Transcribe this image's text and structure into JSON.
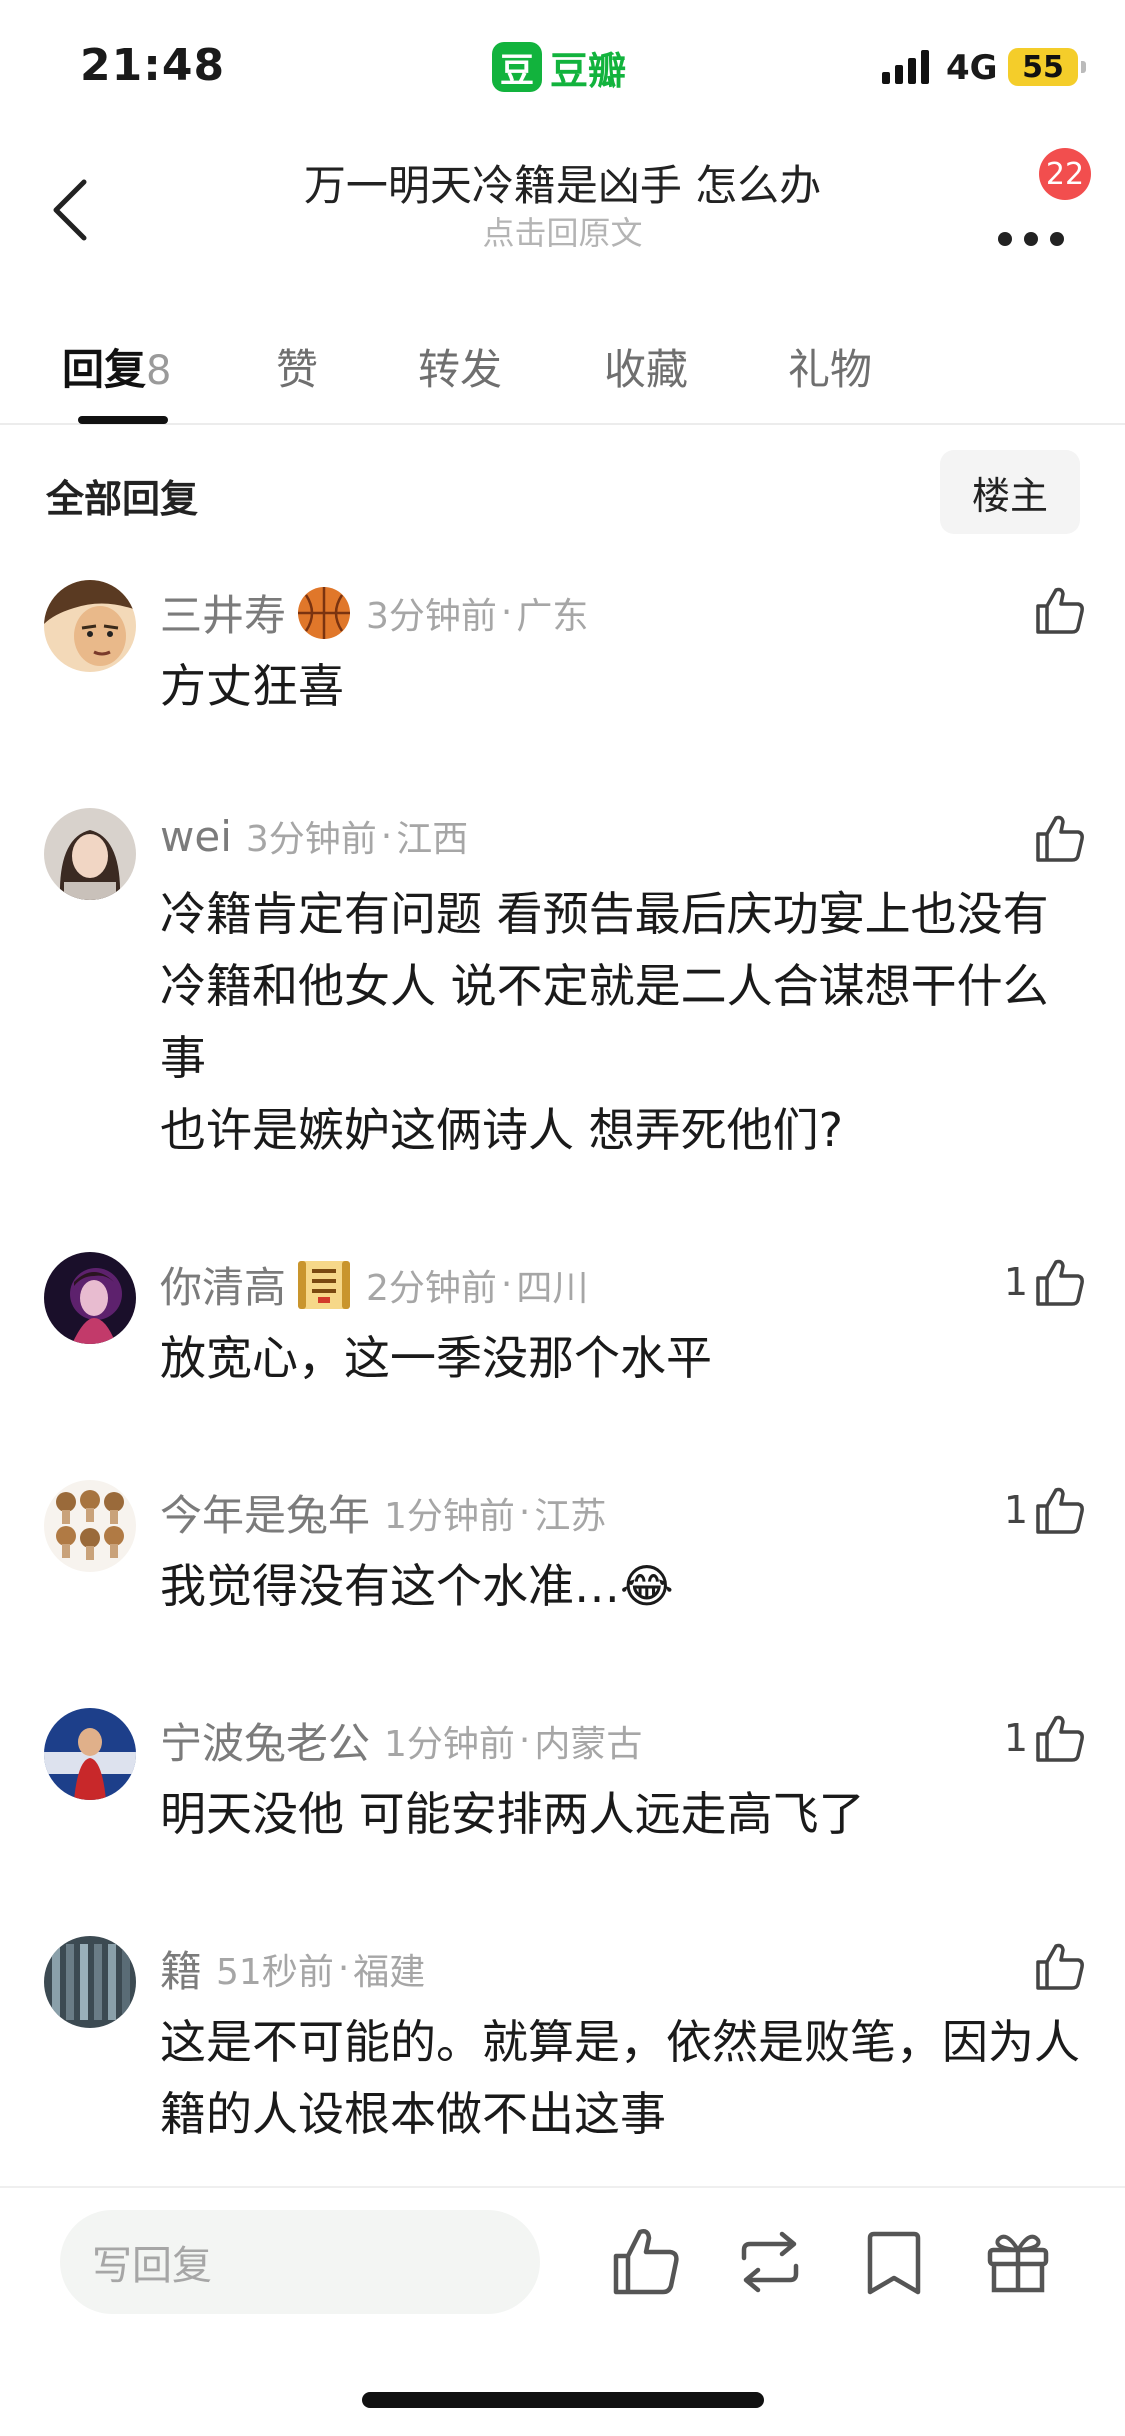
{
  "status_bar": {
    "time": "21:48",
    "app_logo_char": "豆",
    "app_name": "豆瓣",
    "network": "4G",
    "battery": "55"
  },
  "header": {
    "title": "万一明天冷籍是凶手 怎么办",
    "subtitle": "点击回原文",
    "notification_count": "22"
  },
  "tabs": [
    {
      "label": "回复",
      "count": "8",
      "active": true
    },
    {
      "label": "赞"
    },
    {
      "label": "转发"
    },
    {
      "label": "收藏"
    },
    {
      "label": "礼物"
    }
  ],
  "section": {
    "title": "全部回复",
    "filter_button": "楼主"
  },
  "comments": [
    {
      "name": "三井寿",
      "badge_icon": "basketball-icon",
      "time": "3分钟前",
      "location": "广东",
      "text": "方丈狂喜",
      "likes": ""
    },
    {
      "name": "wei",
      "time": "3分钟前",
      "location": "江西",
      "text": "冷籍肯定有问题 看预告最后庆功宴上也没有冷籍和他女人 说不定就是二人合谋想干什么事\n也许是嫉妒这俩诗人 想弄死他们?",
      "likes": ""
    },
    {
      "name": "你清高",
      "badge_icon": "scroll-badge-icon",
      "time": "2分钟前",
      "location": "四川",
      "text": "放宽心，这一季没那个水平",
      "likes": "1"
    },
    {
      "name": "今年是兔年",
      "time": "1分钟前",
      "location": "江苏",
      "text": "我觉得没有这个水准…😂",
      "likes": "1"
    },
    {
      "name": "宁波兔老公",
      "time": "1分钟前",
      "location": "内蒙古",
      "text": "明天没他 可能安排两人远走高飞了",
      "likes": "1"
    },
    {
      "name": "籍",
      "time": "51秒前",
      "location": "福建",
      "text": "这是不可能的。就算是，依然是败笔，因为人籍的人设根本做不出这事",
      "likes": ""
    }
  ],
  "bottom_bar": {
    "reply_placeholder": "写回复",
    "icons": [
      "like-icon",
      "repost-icon",
      "bookmark-icon",
      "gift-icon"
    ]
  },
  "colors": {
    "brand_green": "#12b33d",
    "badge_red": "#f24e4e",
    "battery_yellow": "#f4cd2a"
  }
}
